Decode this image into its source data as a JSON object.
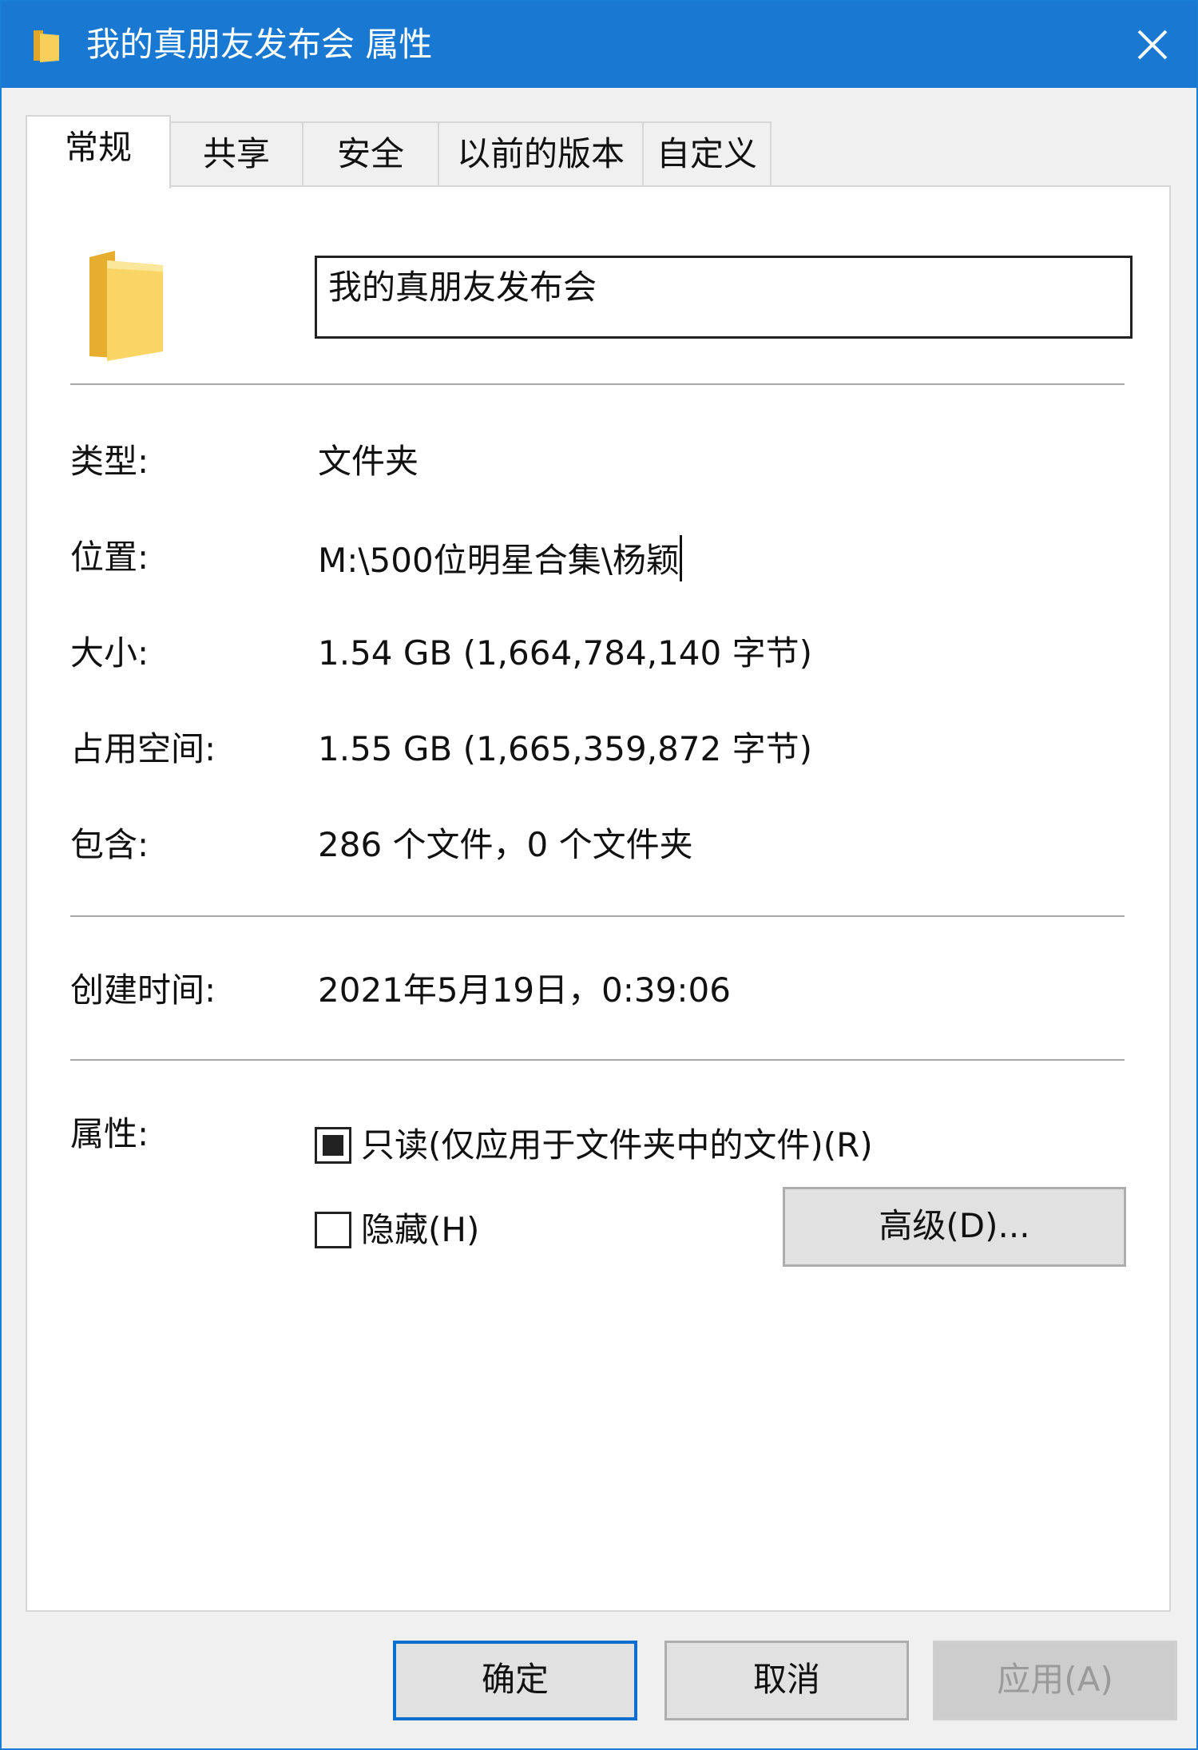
{
  "window": {
    "title": "我的真朋友发布会 属性"
  },
  "tabs": [
    {
      "label": "常规",
      "active": true
    },
    {
      "label": "共享",
      "active": false
    },
    {
      "label": "安全",
      "active": false
    },
    {
      "label": "以前的版本",
      "active": false
    },
    {
      "label": "自定义",
      "active": false
    }
  ],
  "general": {
    "name_value": "我的真朋友发布会",
    "type_label": "类型:",
    "type_value": "文件夹",
    "location_label": "位置:",
    "location_value": "M:\\500位明星合集\\杨颖",
    "size_label": "大小:",
    "size_value": "1.54 GB (1,664,784,140 字节)",
    "disk_label": "占用空间:",
    "disk_value": "1.55 GB (1,665,359,872 字节)",
    "contains_label": "包含:",
    "contains_value": "286 个文件，0 个文件夹",
    "created_label": "创建时间:",
    "created_value": "2021年5月19日，0:39:06",
    "attributes_label": "属性:",
    "readonly_label": "只读(仅应用于文件夹中的文件)(R)",
    "readonly_state": "indeterminate",
    "hidden_label": "隐藏(H)",
    "hidden_state": "unchecked",
    "advanced_label": "高级(D)..."
  },
  "footer": {
    "ok_label": "确定",
    "cancel_label": "取消",
    "apply_label": "应用(A)"
  },
  "colors": {
    "titlebar": "#1979d2",
    "folder": "#f5c94c",
    "default_button_border": "#0a6fd1"
  },
  "icons": {
    "title": "folder-icon",
    "close": "close-icon",
    "main": "folder-icon"
  }
}
